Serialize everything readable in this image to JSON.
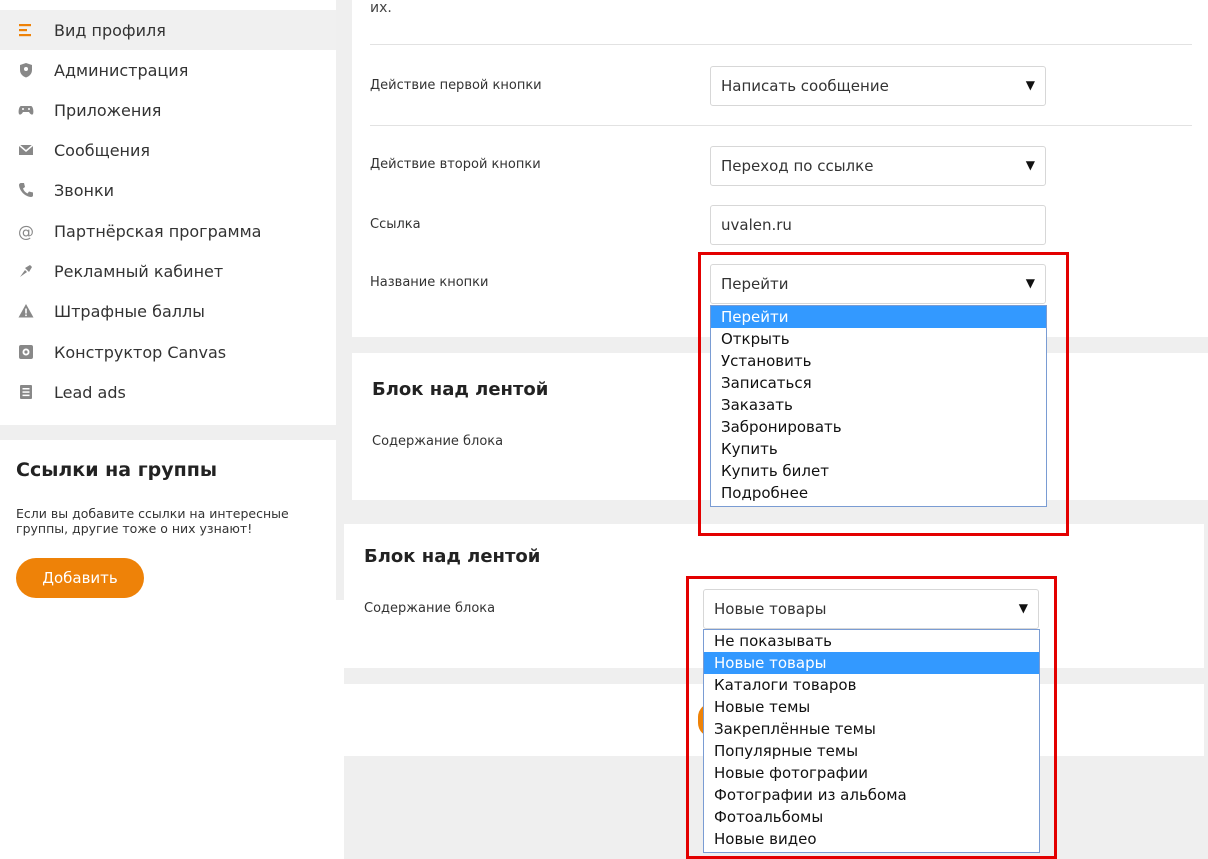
{
  "sidebar": {
    "items": [
      {
        "label": "Вид профиля",
        "icon": "list-lines-icon",
        "active": true
      },
      {
        "label": "Администрация",
        "icon": "shield-icon"
      },
      {
        "label": "Приложения",
        "icon": "gamepad-icon"
      },
      {
        "label": "Сообщения",
        "icon": "envelope-icon"
      },
      {
        "label": "Звонки",
        "icon": "phone-icon"
      },
      {
        "label": "Партнёрская программа",
        "icon": "at-sign-icon"
      },
      {
        "label": "Рекламный кабинет",
        "icon": "megaphone-icon"
      },
      {
        "label": "Штрафные баллы",
        "icon": "warning-icon"
      },
      {
        "label": "Конструктор Canvas",
        "icon": "canvas-icon"
      },
      {
        "label": "Lead ads",
        "icon": "document-icon"
      }
    ]
  },
  "links_block": {
    "title": "Ссылки на группы",
    "text": "Если вы добавите ссылки на интересные группы, другие тоже о них узнают!",
    "button": "Добавить"
  },
  "main": {
    "cut_text": "их.",
    "first_action": {
      "label": "Действие первой кнопки",
      "value": "Написать сообщение"
    },
    "second_action": {
      "label": "Действие второй кнопки",
      "value": "Переход по ссылке"
    },
    "link": {
      "label": "Ссылка",
      "value": "uvalen.ru"
    },
    "button_name": {
      "label": "Название кнопки",
      "value": "Перейти",
      "options": [
        "Перейти",
        "Открыть",
        "Установить",
        "Записаться",
        "Заказать",
        "Забронировать",
        "Купить",
        "Купить билет",
        "Подробнее"
      ],
      "selected_index": 0
    },
    "block1": {
      "title": "Блок над лентой",
      "content_label": "Содержание блока"
    },
    "block2": {
      "title": "Блок над лентой",
      "content_label": "Содержание блока",
      "value": "Новые товары",
      "options": [
        "Не показывать",
        "Новые товары",
        "Каталоги товаров",
        "Новые темы",
        "Закреплённые темы",
        "Популярные темы",
        "Новые фотографии",
        "Фотографии из альбома",
        "Фотоальбомы",
        "Новые видео"
      ],
      "selected_index": 1
    }
  },
  "colors": {
    "accent": "#ee8208",
    "highlight_frame": "#e30000",
    "selected_option": "#3399ff"
  }
}
